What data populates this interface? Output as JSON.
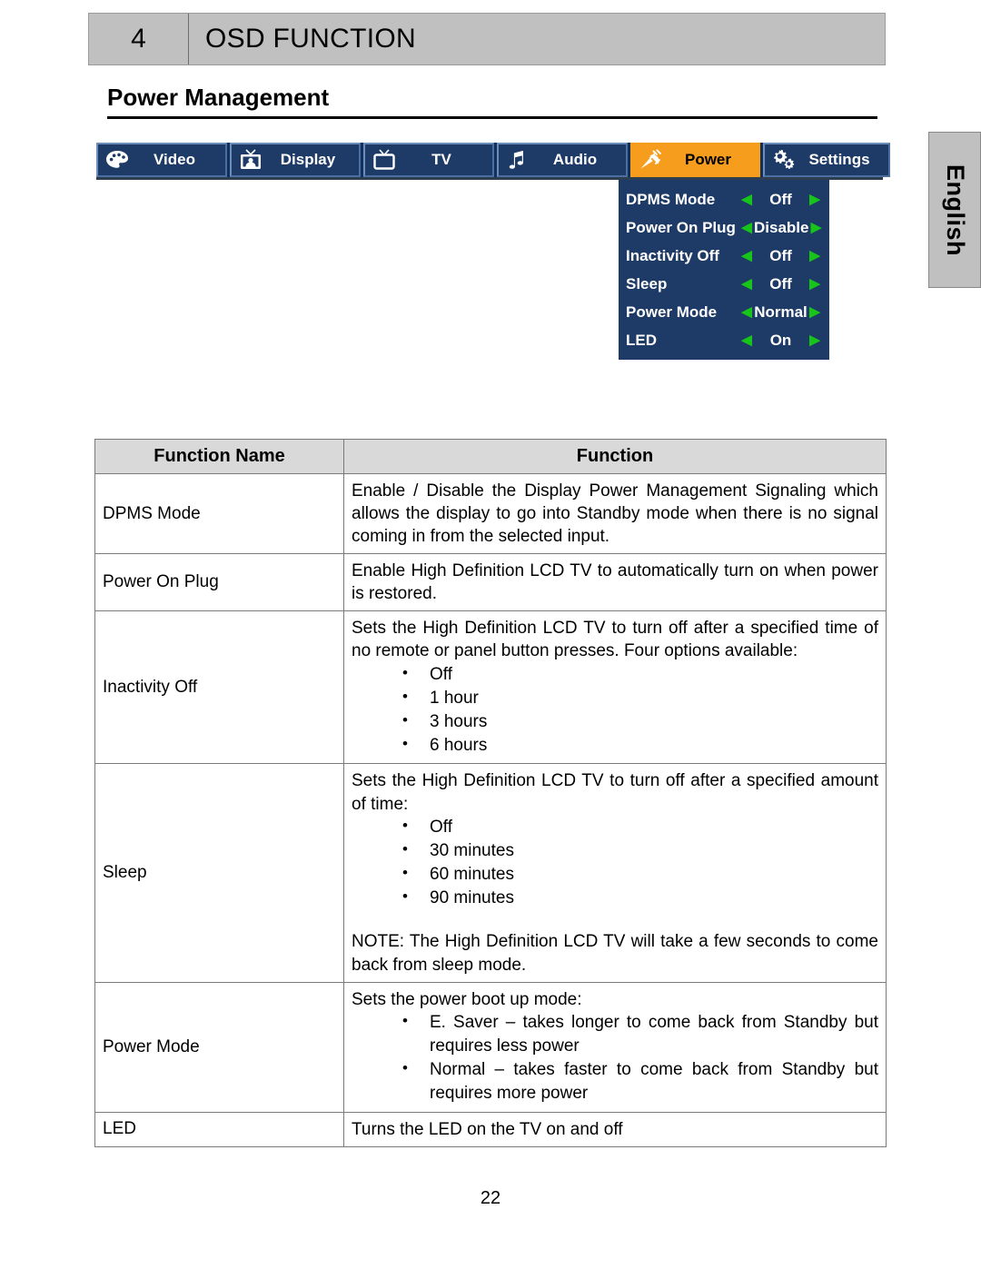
{
  "header": {
    "chapter_number": "4",
    "chapter_title": "OSD FUNCTION"
  },
  "section": {
    "title": "Power Management"
  },
  "language_tab": {
    "label": "English"
  },
  "osd": {
    "accent_color": "#f79d1e",
    "panel_color": "#1d3b66",
    "arrow_color": "#18c41a",
    "tabs": [
      {
        "label": "Video",
        "icon": "palette-icon",
        "active": false
      },
      {
        "label": "Display",
        "icon": "monitor-icon",
        "active": false
      },
      {
        "label": "TV",
        "icon": "tv-icon",
        "active": false
      },
      {
        "label": "Audio",
        "icon": "music-note-icon",
        "active": false
      },
      {
        "label": "Power",
        "icon": "power-plug-icon",
        "active": true
      },
      {
        "label": "Settings",
        "icon": "gears-icon",
        "active": false
      }
    ],
    "left_arrow": "◀",
    "right_arrow": "▶",
    "menu_items": [
      {
        "name": "DPMS Mode",
        "value": "Off"
      },
      {
        "name": "Power On Plug",
        "value": "Disable"
      },
      {
        "name": "Inactivity Off",
        "value": "Off"
      },
      {
        "name": "Sleep",
        "value": "Off"
      },
      {
        "name": "Power Mode",
        "value": "Normal"
      },
      {
        "name": "LED",
        "value": "On"
      }
    ]
  },
  "table": {
    "headers": [
      "Function Name",
      "Function"
    ],
    "rows": [
      {
        "name": "DPMS Mode",
        "paragraphs": [
          "Enable / Disable the Display Power Management Signaling which allows the display to go into Standby mode when there is no signal coming in from the selected input."
        ],
        "bullets": []
      },
      {
        "name": "Power On Plug",
        "paragraphs": [
          "Enable High Definition LCD TV to automatically turn on when power is restored."
        ],
        "bullets": []
      },
      {
        "name": "Inactivity Off",
        "paragraphs": [
          "Sets the High Definition LCD TV to turn off after a specified time of no remote or panel button presses. Four options available:"
        ],
        "bullets": [
          "Off",
          "1 hour",
          "3 hours",
          "6 hours"
        ]
      },
      {
        "name": "Sleep",
        "paragraphs": [
          "Sets the High Definition LCD TV to turn off after a specified amount of time:"
        ],
        "bullets": [
          "Off",
          "30 minutes",
          "60 minutes",
          "90 minutes"
        ],
        "note": "NOTE: The High Definition LCD TV will take a few seconds to come back from sleep mode."
      },
      {
        "name": "Power Mode",
        "paragraphs": [
          "Sets the power boot up mode:"
        ],
        "bullets": [
          "E. Saver – takes longer to come back from Standby but requires less power",
          "Normal – takes faster to come back from Standby but requires more power"
        ]
      },
      {
        "name": "LED",
        "paragraphs": [
          "Turns the LED on the TV on and off"
        ],
        "bullets": []
      }
    ]
  },
  "footer": {
    "page_number": "22"
  }
}
